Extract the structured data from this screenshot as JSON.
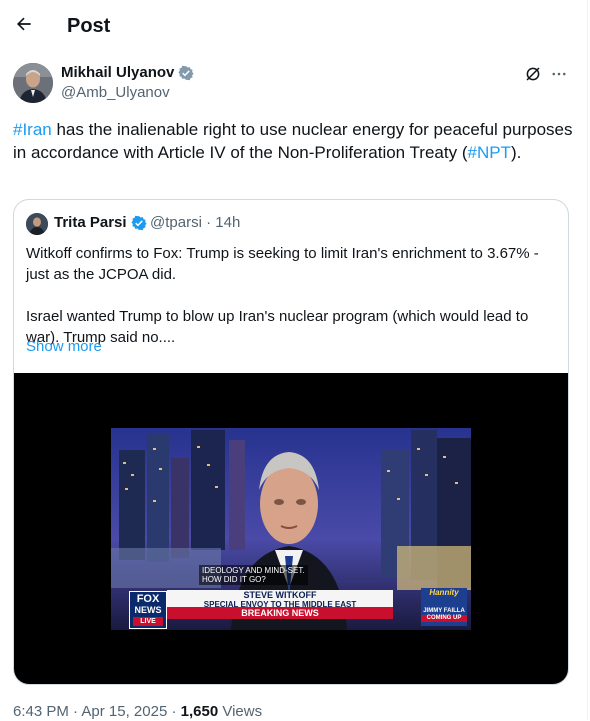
{
  "header": {
    "title": "Post"
  },
  "author": {
    "name": "Mikhail Ulyanov",
    "handle": "@Amb_Ulyanov"
  },
  "tweet": {
    "hashtag_iran": "#Iran",
    "text_1": " has the inalienable right to use nuclear energy for peaceful purposes in accordance with Article IV of the  Non-Proliferation Treaty (",
    "hashtag_npt": "#NPT",
    "text_2": ")."
  },
  "quote": {
    "name": "Trita Parsi",
    "handle": "@tparsi",
    "separator": "·",
    "time": "14h",
    "paragraph_1": "Witkoff confirms to Fox: Trump is seeking to limit Iran's enrichment to 3.67% - just as the JCPOA did.",
    "paragraph_2": "Israel wanted Trump to blow up Iran's nuclear program (which would lead to war). Trump said no....",
    "show_more": "Show more"
  },
  "video": {
    "caption": "IDEOLOGY AND MIND-SET.\nHOW DID IT GO?",
    "logo_line1": "FOX",
    "logo_line2": "NEWS",
    "logo_line3": "LIVE",
    "name_line1": "STEVE WITKOFF",
    "name_line2": "SPECIAL ENVOY TO THE MIDDLE EAST",
    "breaking": "BREAKING NEWS",
    "show_title": "Hannity",
    "show_guest": "JIMMY FAILLA",
    "show_status": "COMING UP"
  },
  "footer": {
    "time": "6:43 PM",
    "dot": "·",
    "date": "Apr 15, 2025",
    "views_count": "1,650",
    "views_label": "Views"
  },
  "colors": {
    "accent": "#1d9bf0",
    "text": "#0f1419",
    "muted": "#536471",
    "border": "#cfd9de",
    "breaking": "#c8102e"
  },
  "icons": [
    "back-arrow-icon",
    "verified-badge-icon",
    "grok-icon",
    "more-icon"
  ]
}
